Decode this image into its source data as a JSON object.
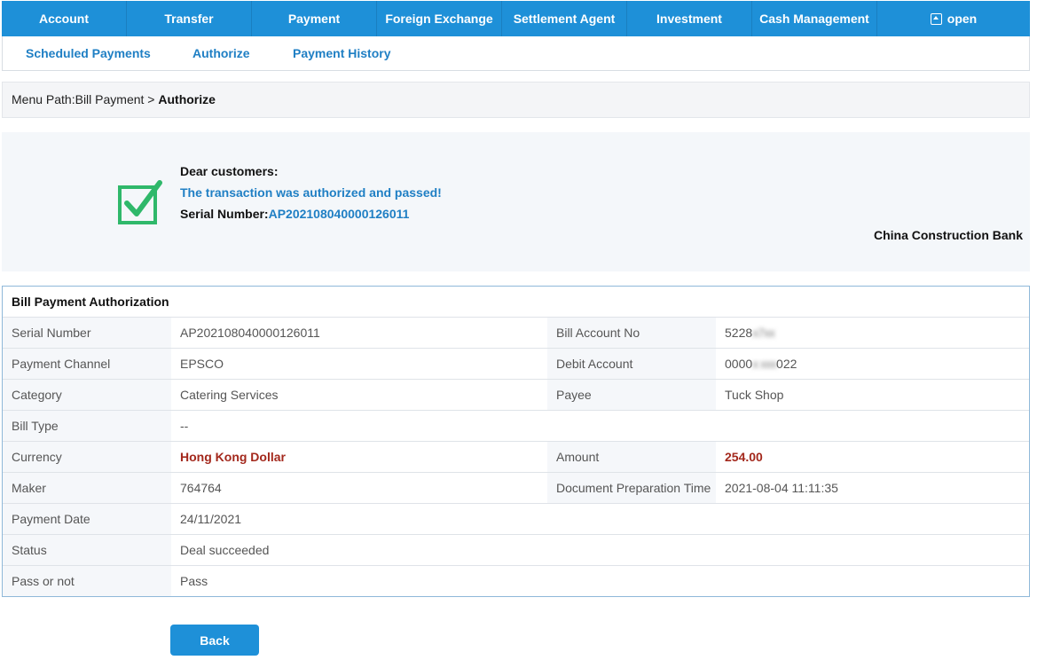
{
  "topnav": {
    "items": [
      "Account",
      "Transfer",
      "Payment",
      "Foreign Exchange",
      "Settlement Agent",
      "Investment",
      "Cash Management"
    ],
    "open_label": "open"
  },
  "subnav": {
    "items": [
      "Scheduled Payments",
      "Authorize",
      "Payment History"
    ]
  },
  "breadcrumb": {
    "prefix": "Menu Path:Bill Payment > ",
    "current": "Authorize"
  },
  "result": {
    "greeting": "Dear customers:",
    "message": "The transaction was authorized and passed!",
    "serial_label": "Serial Number:",
    "serial_value": "AP202108040000126011",
    "bank": "China Construction Bank"
  },
  "details": {
    "title": "Bill Payment Authorization",
    "rows": [
      {
        "label1": "Serial Number",
        "value1": "AP202108040000126011",
        "label2": "Bill Account No",
        "value2_pre": "5228",
        "value2_blur": "x7xx",
        "value2_post": ""
      },
      {
        "label1": "Payment Channel",
        "value1": "EPSCO",
        "label2": "Debit Account",
        "value2_pre": "0000",
        "value2_blur": "x xxx",
        "value2_post": "022"
      },
      {
        "label1": "Category",
        "value1": "Catering Services",
        "label2": "Payee",
        "value2": "Tuck Shop"
      },
      {
        "label1": "Bill Type",
        "value1": "--"
      },
      {
        "label1": "Currency",
        "value1": "Hong Kong Dollar",
        "label2": "Amount",
        "value2": "254.00"
      },
      {
        "label1": "Maker",
        "value1": "764764",
        "label2": "Document Preparation Time",
        "value2": "2021-08-04 11:11:35"
      },
      {
        "label1": "Payment Date",
        "value1": "24/11/2021"
      },
      {
        "label1": "Status",
        "value1": "Deal succeeded"
      },
      {
        "label1": "Pass or not",
        "value1": "Pass"
      }
    ]
  },
  "back_button": "Back",
  "colors": {
    "primary": "#1e90d8",
    "link": "#1f7fc4",
    "success_green": "#2fb86a",
    "emphasis_red": "#a3281c"
  }
}
